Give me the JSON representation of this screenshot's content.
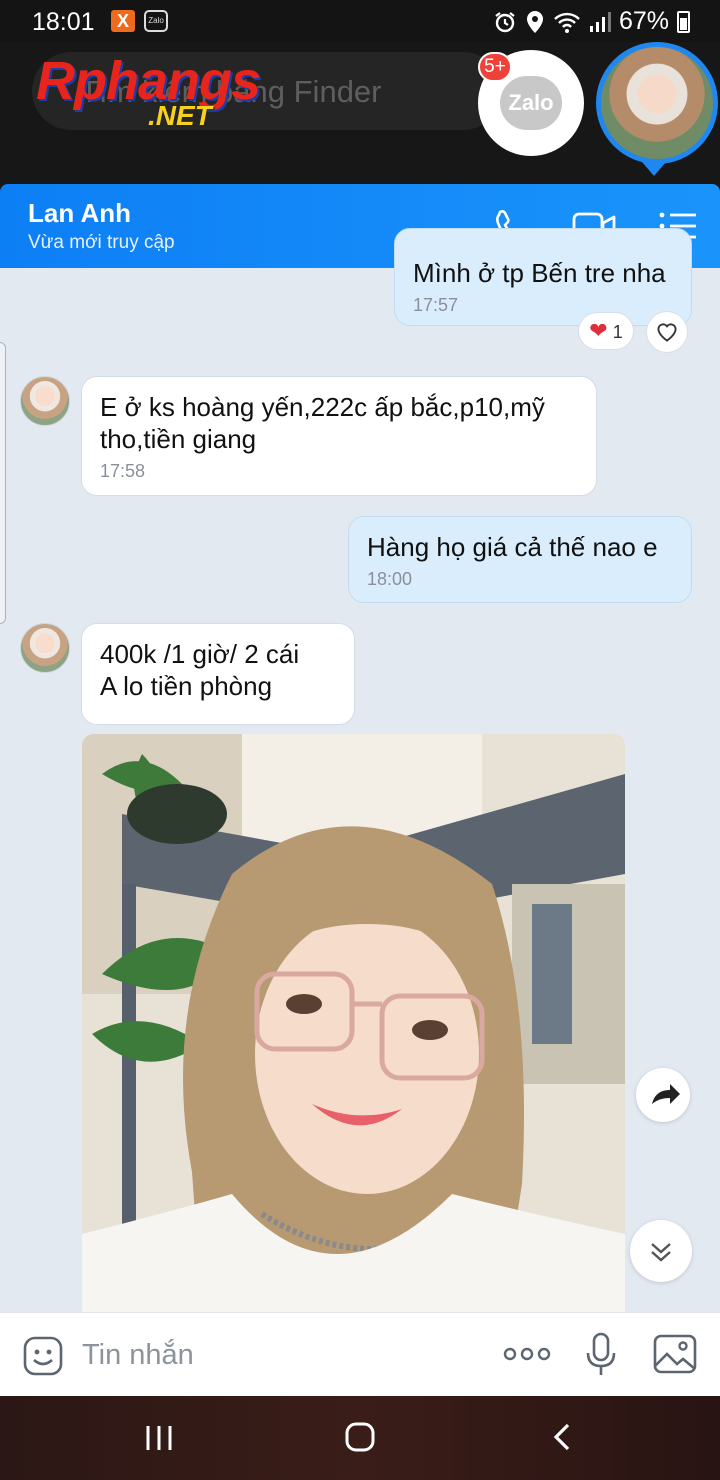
{
  "status_bar": {
    "time": "18:01",
    "app_badge_1": "X",
    "app_badge_2": "Zalo",
    "battery": "67%"
  },
  "overlay": {
    "search_placeholder": "Tìm kiếm bằng Finder",
    "watermark_top": "Rphangs",
    "watermark_bottom": ".NET",
    "zalo_bubble_label": "Zalo",
    "notification_count": "5+"
  },
  "header": {
    "contact_name": "Lan Anh",
    "contact_status": "Vừa mới truy cập",
    "icons": [
      "phone-icon",
      "video-call-icon",
      "menu-list-icon"
    ]
  },
  "messages": [
    {
      "direction": "out",
      "text": "Mình ở tp Bến tre nha",
      "time": "17:57",
      "reaction": {
        "emoji": "❤",
        "count": "1"
      }
    },
    {
      "direction": "in",
      "text_lines": [
        "E ở  ks hoàng yến,222c ấp bắc,p10,mỹ",
        "tho,tiền giang"
      ],
      "time": "17:58"
    },
    {
      "direction": "out",
      "text": "Hàng họ giá cả thế nao e",
      "time": "18:00"
    },
    {
      "direction": "in",
      "text_lines": [
        "400k /1 giờ/ 2 cái",
        "A lo tiền phòng"
      ]
    },
    {
      "direction": "in",
      "type": "photo"
    }
  ],
  "composer": {
    "placeholder": "Tin nhắn",
    "icons": [
      "sticker-icon",
      "more-icon",
      "microphone-icon",
      "image-icon"
    ]
  },
  "colors": {
    "header_blue": "#0d7ff5",
    "outgoing_bubble": "#daedfd",
    "chat_background": "#e2e9f1",
    "heart_red": "#e02d3c"
  }
}
